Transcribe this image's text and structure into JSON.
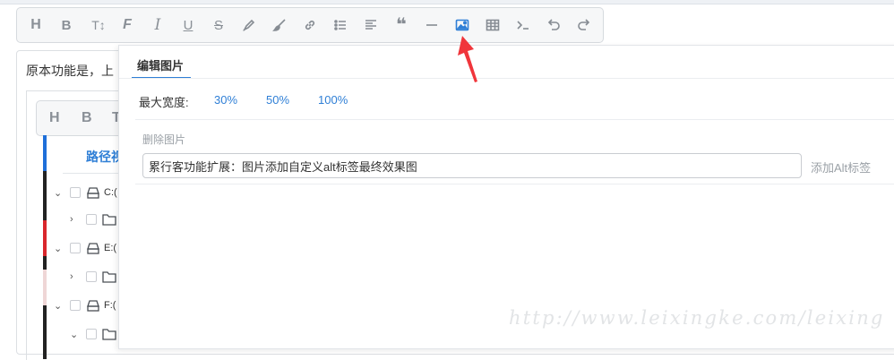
{
  "toolbar": {
    "buttons": [
      {
        "name": "heading",
        "glyph": "H"
      },
      {
        "name": "bold",
        "glyph": "B"
      },
      {
        "name": "font-size",
        "glyph": "T↕"
      },
      {
        "name": "font-family",
        "glyph": "F"
      },
      {
        "name": "italic",
        "glyph": "I"
      },
      {
        "name": "underline",
        "glyph": "U"
      },
      {
        "name": "strikethrough",
        "glyph": "S"
      },
      {
        "name": "highlighter",
        "glyph": "✎"
      },
      {
        "name": "brush",
        "glyph": "🖌"
      },
      {
        "name": "link",
        "glyph": "⛓"
      },
      {
        "name": "bulleted-list",
        "glyph": "☰"
      },
      {
        "name": "align",
        "glyph": "≡"
      },
      {
        "name": "quote",
        "glyph": "❝"
      },
      {
        "name": "horizontal-rule",
        "glyph": "—"
      },
      {
        "name": "image",
        "glyph": "▣",
        "active": true
      },
      {
        "name": "table",
        "glyph": "▦"
      },
      {
        "name": "code",
        "glyph": ">_"
      },
      {
        "name": "undo",
        "glyph": "↶"
      },
      {
        "name": "redo",
        "glyph": "↷"
      }
    ],
    "active_color": "#2f7fd6"
  },
  "editor": {
    "text": "原本功能是，上",
    "inner_toolbar": [
      "H",
      "B",
      "T"
    ],
    "tree": {
      "tab_label": "路径视",
      "rows": [
        {
          "label": "C:(",
          "type": "drive",
          "expanded": true
        },
        {
          "label": "",
          "type": "folder",
          "expanded": false
        },
        {
          "label": "E:(",
          "type": "drive",
          "expanded": true
        },
        {
          "label": "",
          "type": "folder",
          "expanded": false
        },
        {
          "label": "F:(",
          "type": "drive",
          "expanded": true
        },
        {
          "label": "",
          "type": "folder",
          "expanded": true
        }
      ]
    }
  },
  "popover": {
    "tab_label": "编辑图片",
    "max_width_label": "最大宽度:",
    "width_options": [
      "30%",
      "50%",
      "100%"
    ],
    "delete_label": "删除图片",
    "alt_input_value": "累行客功能扩展：图片添加自定义alt标签最终效果图",
    "add_alt_label": "添加Alt标签"
  },
  "annotation": {
    "arrow_color": "#f0353b"
  },
  "watermark": "http://www.leixingke.com/leixing"
}
